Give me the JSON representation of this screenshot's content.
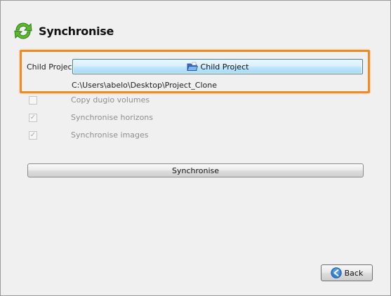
{
  "header": {
    "title": "Synchronise",
    "icon": "sync-arrows-icon"
  },
  "child_project": {
    "label": "Child Project",
    "button_label": "Child Project",
    "button_icon": "folder-open-icon",
    "path": "C:\\Users\\abelo\\Desktop\\Project_Clone"
  },
  "options": [
    {
      "label": "Copy dugio volumes",
      "checked": false,
      "enabled": false
    },
    {
      "label": "Synchronise horizons",
      "checked": true,
      "enabled": false
    },
    {
      "label": "Synchronise images",
      "checked": true,
      "enabled": false
    }
  ],
  "actions": {
    "synchronise_label": "Synchronise",
    "back_label": "Back",
    "back_icon": "back-arrow-icon"
  },
  "colors": {
    "highlight": "#f28a22",
    "sync_icon_green": "#5cb82e",
    "back_icon_blue": "#2f7fd1"
  }
}
